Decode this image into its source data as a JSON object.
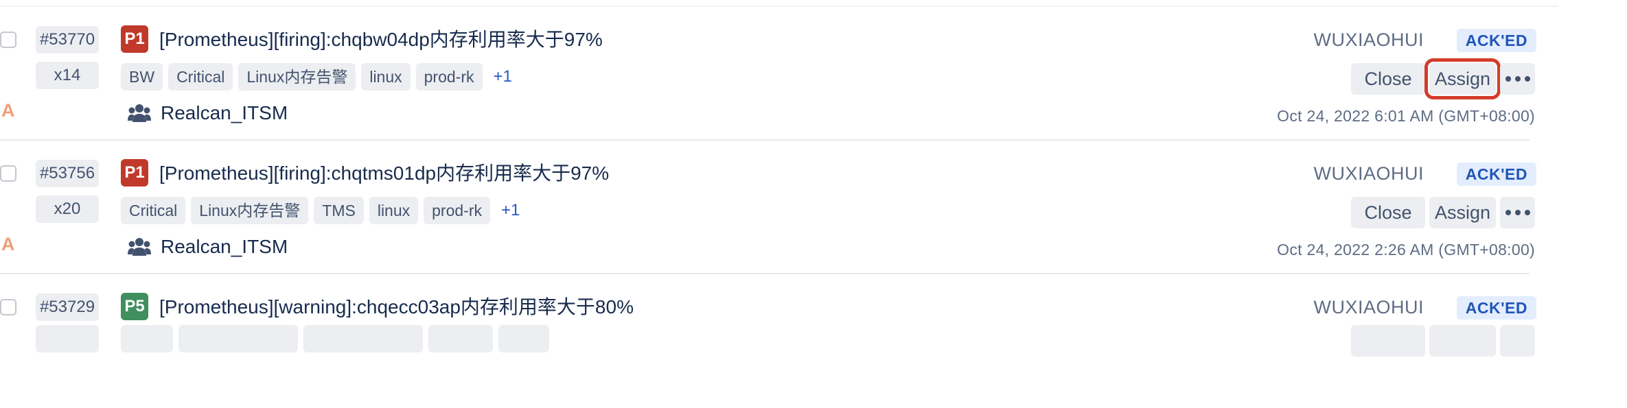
{
  "colors": {
    "p1": "#c0392b",
    "p5": "#3f8f5f",
    "ack_bg": "#e3edfd",
    "ack_text": "#1f55b8",
    "highlight": "#d33c2a"
  },
  "incidents": [
    {
      "id": "#53770",
      "count": "x14",
      "priority": "P1",
      "title": "[Prometheus][firing]:chqbw04dp内存利用率大于97%",
      "tags": [
        "BW",
        "Critical",
        "Linux内存告警",
        "linux",
        "prod-rk"
      ],
      "more_tags": "+1",
      "assignee": "WUXIAOHUI",
      "status": "ACK'ED",
      "close_label": "Close",
      "assign_label": "Assign",
      "more_icon": "more-horizontal-icon",
      "a_mark": "A",
      "team_icon": "team-icon",
      "team": "Realcan_ITSM",
      "timestamp": "Oct 24, 2022 6:01 AM (GMT+08:00)"
    },
    {
      "id": "#53756",
      "count": "x20",
      "priority": "P1",
      "title": "[Prometheus][firing]:chqtms01dp内存利用率大于97%",
      "tags": [
        "Critical",
        "Linux内存告警",
        "TMS",
        "linux",
        "prod-rk"
      ],
      "more_tags": "+1",
      "assignee": "WUXIAOHUI",
      "status": "ACK'ED",
      "close_label": "Close",
      "assign_label": "Assign",
      "more_icon": "more-horizontal-icon",
      "a_mark": "A",
      "team_icon": "team-icon",
      "team": "Realcan_ITSM",
      "timestamp": "Oct 24, 2022 2:26 AM (GMT+08:00)"
    },
    {
      "id": "#53729",
      "priority": "P5",
      "title": "[Prometheus][warning]:chqecc03ap内存利用率大于80%",
      "assignee": "WUXIAOHUI",
      "status": "ACK'ED"
    }
  ]
}
